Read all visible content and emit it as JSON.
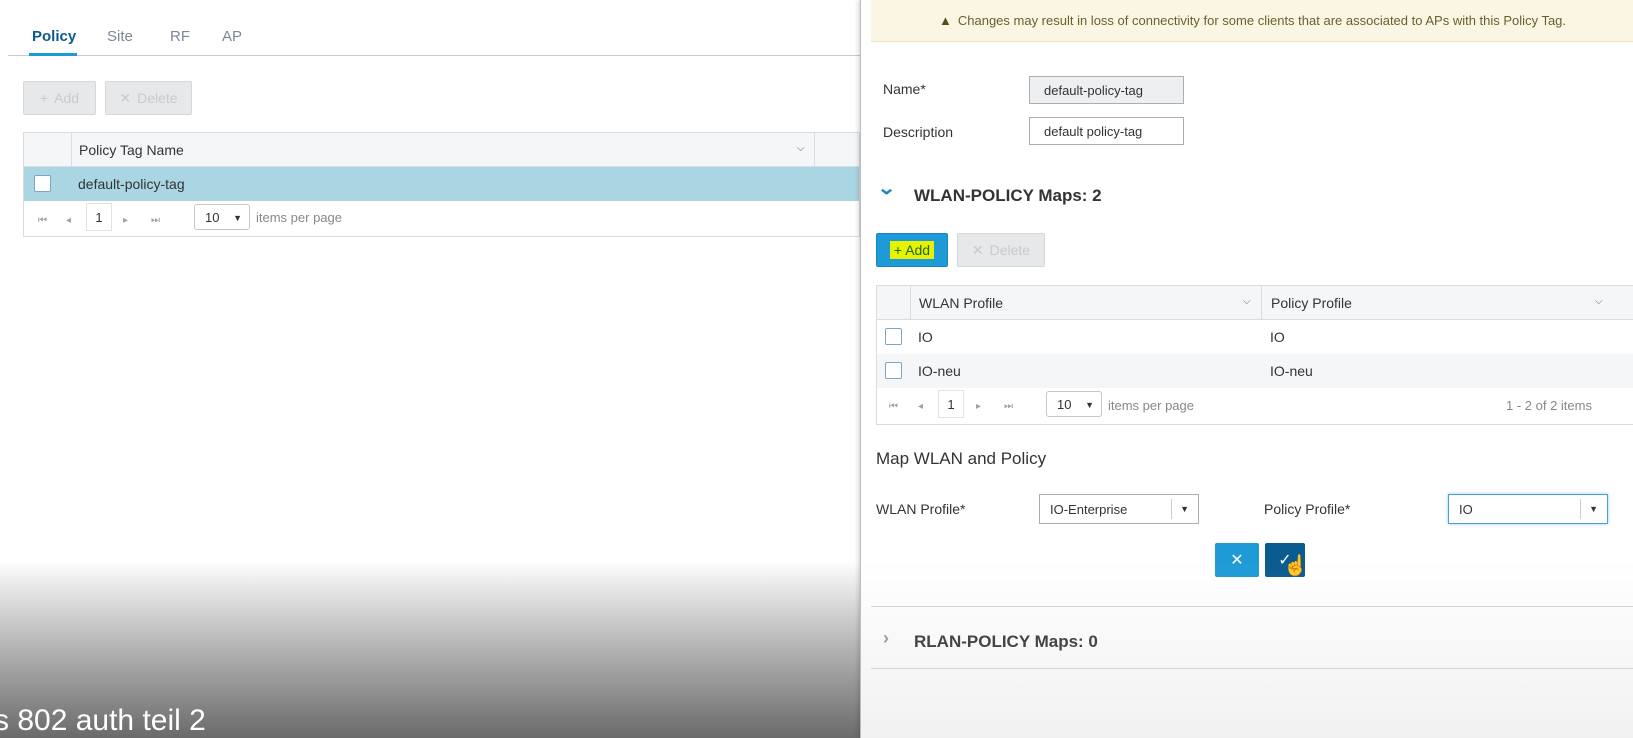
{
  "tabs": [
    {
      "label": "Policy",
      "active": true
    },
    {
      "label": "Site",
      "active": false
    },
    {
      "label": "RF",
      "active": false
    },
    {
      "label": "AP",
      "active": false
    }
  ],
  "left_toolbar": {
    "add_label": "Add",
    "delete_label": "Delete"
  },
  "policy_table": {
    "columns": [
      "Policy Tag Name"
    ],
    "rows": [
      {
        "name": "default-policy-tag",
        "selected": true
      }
    ],
    "pager": {
      "page": "1",
      "per_page": "10",
      "per_page_label": "items per page"
    }
  },
  "caption": "s 802 auth teil 2",
  "panel": {
    "warning": "Changes may result in loss of connectivity for some clients that are associated to APs with this Policy Tag.",
    "name_label": "Name*",
    "name_value": "default-policy-tag",
    "description_label": "Description",
    "description_value": "default policy-tag",
    "wlan_section_title": "WLAN-POLICY Maps: 2",
    "add_label": "Add",
    "delete_label": "Delete",
    "map_table": {
      "columns": [
        "WLAN Profile",
        "Policy Profile"
      ],
      "rows": [
        {
          "wlan": "IO",
          "policy": "IO"
        },
        {
          "wlan": "IO-neu",
          "policy": "IO-neu"
        }
      ],
      "pager": {
        "page": "1",
        "per_page": "10",
        "per_page_label": "items per page",
        "summary": "1 - 2 of 2 items"
      }
    },
    "map_title": "Map WLAN and Policy",
    "wlan_profile_label": "WLAN Profile*",
    "wlan_profile_value": "IO-Enterprise",
    "policy_profile_label": "Policy Profile*",
    "policy_profile_value": "IO",
    "rlan_section_title": "RLAN-POLICY Maps: 0"
  },
  "colors": {
    "accent": "#1e9bd6",
    "dark_button": "#0a5b8f",
    "selected_row": "#a9d6e2",
    "highlight": "#e6f200"
  }
}
